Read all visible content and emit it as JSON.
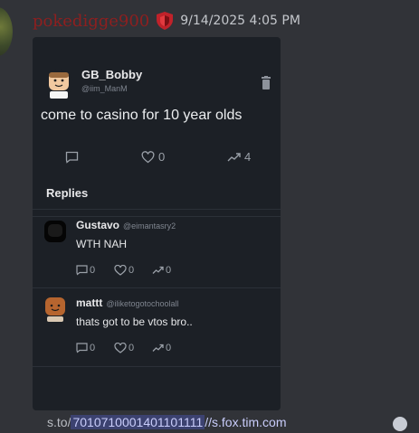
{
  "message": {
    "username": "pokedigge900",
    "timestamp": "9/14/2025 4:05 PM"
  },
  "post": {
    "user": "GB_Bobby",
    "handle": "@iim_ManM",
    "text": "come to casino for 10 year olds",
    "likes": "0",
    "reposts": "4"
  },
  "replies": {
    "title": "Replies",
    "items": [
      {
        "user": "Gustavo",
        "handle": "@eimantasry2",
        "text": "WTH NAH",
        "comments": "0",
        "likes": "0",
        "reposts": "0"
      },
      {
        "user": "mattt",
        "handle": "@iliketogotochoolall",
        "text": "thats got to be vtos bro..",
        "comments": "0",
        "likes": "0",
        "reposts": "0"
      }
    ]
  },
  "footer": {
    "prefix": "s.to/",
    "link_text": "7010710001401101111",
    "link_text2": "//s.fox.tim.com"
  },
  "colors": {
    "background": "#313338",
    "embed_bg": "#1c2026",
    "username": "#8e1f1f"
  }
}
